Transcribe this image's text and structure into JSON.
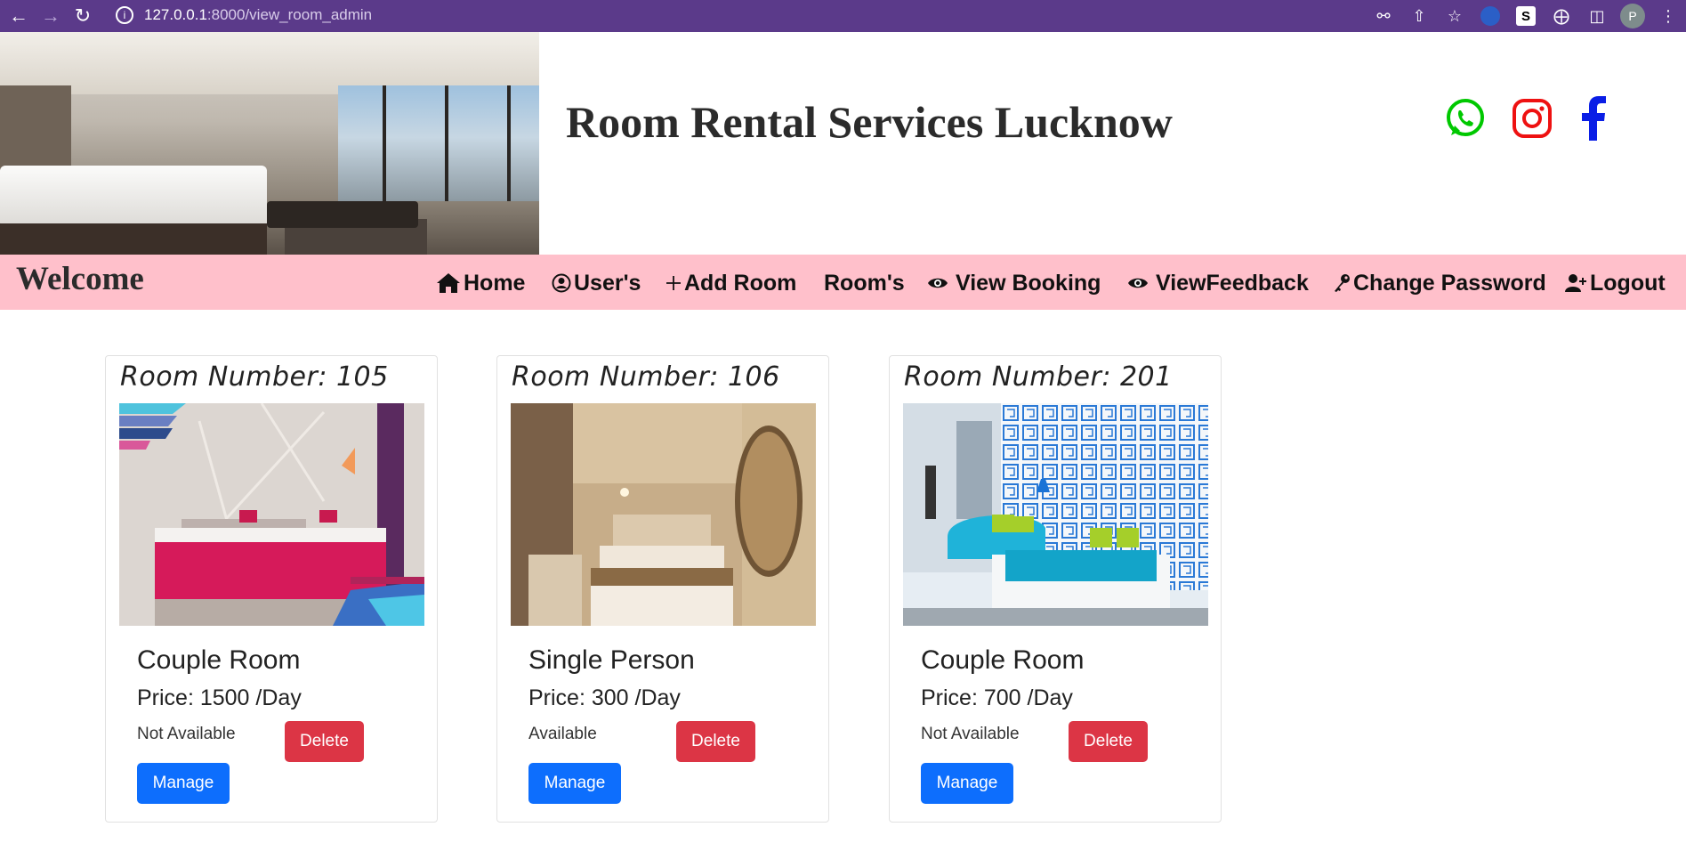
{
  "browser": {
    "url_host": "127.0.0.1",
    "url_path": ":8000/view_room_admin",
    "profile_initial": "P",
    "extension_label": "S"
  },
  "header": {
    "site_title": "Room Rental Services Lucknow",
    "social": [
      {
        "name": "whatsapp-icon",
        "color": "#00c800"
      },
      {
        "name": "instagram-icon",
        "color": "#ee1111"
      },
      {
        "name": "facebook-icon",
        "color": "#0a1ee6"
      }
    ]
  },
  "navbar": {
    "welcome": "Welcome",
    "items": [
      {
        "label": "Home",
        "icon": "home-icon"
      },
      {
        "label": "User's",
        "icon": "user-circle-icon"
      },
      {
        "label": "Add Room",
        "icon": "plus-icon"
      },
      {
        "label": "Room's",
        "icon": ""
      },
      {
        "label": "View Booking",
        "icon": "eye-icon"
      },
      {
        "label": "ViewFeedback",
        "icon": "eye-icon"
      },
      {
        "label": "Change Password",
        "icon": "key-icon"
      },
      {
        "label": "Logout",
        "icon": "user-add-icon"
      }
    ]
  },
  "rooms": [
    {
      "room_number": "Room Number: 105",
      "type": "Couple Room",
      "price": "Price: 1500 /Day",
      "availability": "Not Available",
      "delete_label": "Delete",
      "manage_label": "Manage"
    },
    {
      "room_number": "Room Number: 106",
      "type": "Single Person",
      "price": "Price: 300 /Day",
      "availability": "Available",
      "delete_label": "Delete",
      "manage_label": "Manage"
    },
    {
      "room_number": "Room Number: 201",
      "type": "Couple Room",
      "price": "Price: 700 /Day",
      "availability": "Not Available",
      "delete_label": "Delete",
      "manage_label": "Manage"
    }
  ],
  "colors": {
    "browser_bar": "#5b3a8a",
    "navbar_bg": "#ffc0cb",
    "delete": "#dc3545",
    "manage": "#0d6efd"
  }
}
